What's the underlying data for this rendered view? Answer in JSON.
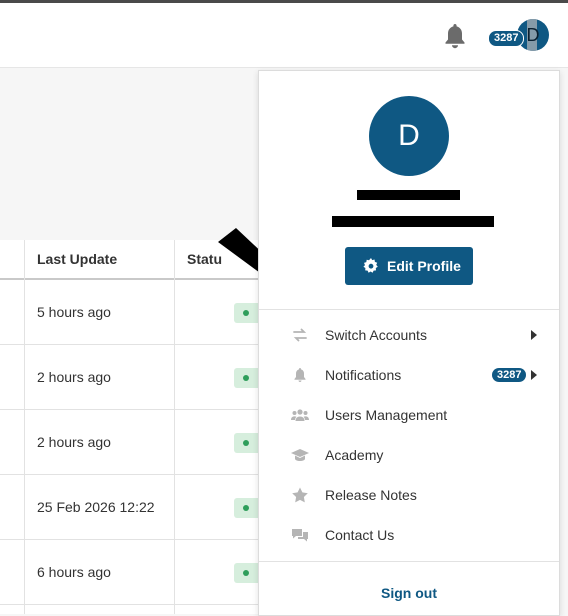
{
  "header": {
    "notification_count": "3287",
    "avatar_initial": "D"
  },
  "table": {
    "columns": [
      "Last Update",
      "Statu"
    ],
    "rows": [
      {
        "last_update": "5 hours ago"
      },
      {
        "last_update": "2 hours ago"
      },
      {
        "last_update": "2 hours ago"
      },
      {
        "last_update": "25 Feb 2026 12:22"
      },
      {
        "last_update": "6 hours ago"
      }
    ]
  },
  "profile_menu": {
    "avatar_initial": "D",
    "edit_profile_label": "Edit Profile",
    "items": [
      {
        "label": "Switch Accounts",
        "icon": "switch-icon"
      },
      {
        "label": "Notifications",
        "icon": "bell-icon",
        "badge": "3287"
      },
      {
        "label": "Users Management",
        "icon": "users-icon"
      },
      {
        "label": "Academy",
        "icon": "graduation-cap-icon"
      },
      {
        "label": "Release Notes",
        "icon": "star-icon"
      },
      {
        "label": "Contact Us",
        "icon": "chat-icon"
      }
    ],
    "sign_out_label": "Sign out"
  },
  "colors": {
    "brand": "#0f5883",
    "status_green": "#2e9e5b"
  }
}
